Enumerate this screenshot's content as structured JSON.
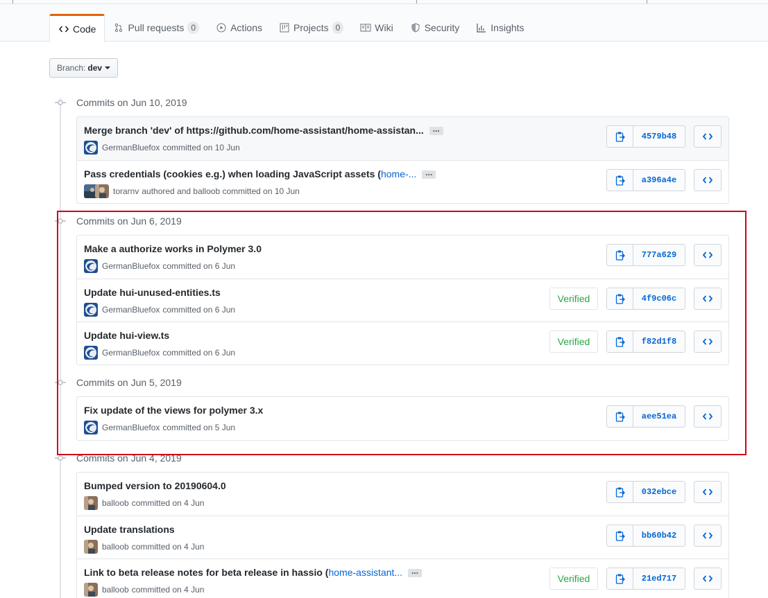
{
  "tabs": [
    {
      "label": "Code",
      "icon": "code-icon",
      "selected": true
    },
    {
      "label": "Pull requests",
      "icon": "pull-request-icon",
      "counter": "0"
    },
    {
      "label": "Actions",
      "icon": "play-icon"
    },
    {
      "label": "Projects",
      "icon": "project-icon",
      "counter": "0"
    },
    {
      "label": "Wiki",
      "icon": "book-icon"
    },
    {
      "label": "Security",
      "icon": "shield-icon"
    },
    {
      "label": "Insights",
      "icon": "graph-icon"
    }
  ],
  "branch": {
    "label": "Branch:",
    "value": "dev"
  },
  "groups": [
    {
      "date": "Commits on Jun 10, 2019",
      "commits": [
        {
          "title": "Merge branch 'dev' of https://github.com/home-assistant/home-assistan...",
          "issue": "",
          "ellipsis": true,
          "author": "GermanBluefox",
          "meta": "committed on 10 Jun",
          "sha": "4579b48",
          "verified": false
        },
        {
          "title": "Pass credentials (cookies e.g.) when loading JavaScript assets (",
          "issue": "home-...",
          "ellipsis": true,
          "author": "torarnv",
          "meta": "authored and balloob committed on 10 Jun",
          "sha": "a396a4e",
          "verified": false
        }
      ]
    },
    {
      "date": "Commits on Jun 6, 2019",
      "commits": [
        {
          "title": "Make a authorize works in Polymer 3.0",
          "issue": "",
          "ellipsis": false,
          "author": "GermanBluefox",
          "meta": "committed on 6 Jun",
          "sha": "777a629",
          "verified": false
        },
        {
          "title": "Update hui-unused-entities.ts",
          "issue": "",
          "ellipsis": false,
          "author": "GermanBluefox",
          "meta": "committed on 6 Jun",
          "sha": "4f9c06c",
          "verified": true
        },
        {
          "title": "Update hui-view.ts",
          "issue": "",
          "ellipsis": false,
          "author": "GermanBluefox",
          "meta": "committed on 6 Jun",
          "sha": "f82d1f8",
          "verified": true
        }
      ]
    },
    {
      "date": "Commits on Jun 5, 2019",
      "commits": [
        {
          "title": "Fix update of the views for polymer 3.x",
          "issue": "",
          "ellipsis": false,
          "author": "GermanBluefox",
          "meta": "committed on 5 Jun",
          "sha": "aee51ea",
          "verified": false
        }
      ]
    },
    {
      "date": "Commits on Jun 4, 2019",
      "commits": [
        {
          "title": "Bumped version to 20190604.0",
          "issue": "",
          "ellipsis": false,
          "author": "balloob",
          "meta": "committed on 4 Jun",
          "sha": "032ebce",
          "verified": false
        },
        {
          "title": "Update translations",
          "issue": "",
          "ellipsis": false,
          "author": "balloob",
          "meta": "committed on 4 Jun",
          "sha": "bb60b42",
          "verified": false
        },
        {
          "title": "Link to beta release notes for beta release in hassio (",
          "issue": "home-assistant...",
          "ellipsis": true,
          "author": "balloob",
          "meta": "committed on 4 Jun",
          "sha": "21ed717",
          "verified": true
        }
      ]
    }
  ],
  "verified_label": "Verified",
  "ellipsis_label": "...",
  "colors": {
    "accent": "#e36209",
    "link": "#0366d6",
    "verified": "#28a745",
    "annotation": "#d0021b"
  }
}
